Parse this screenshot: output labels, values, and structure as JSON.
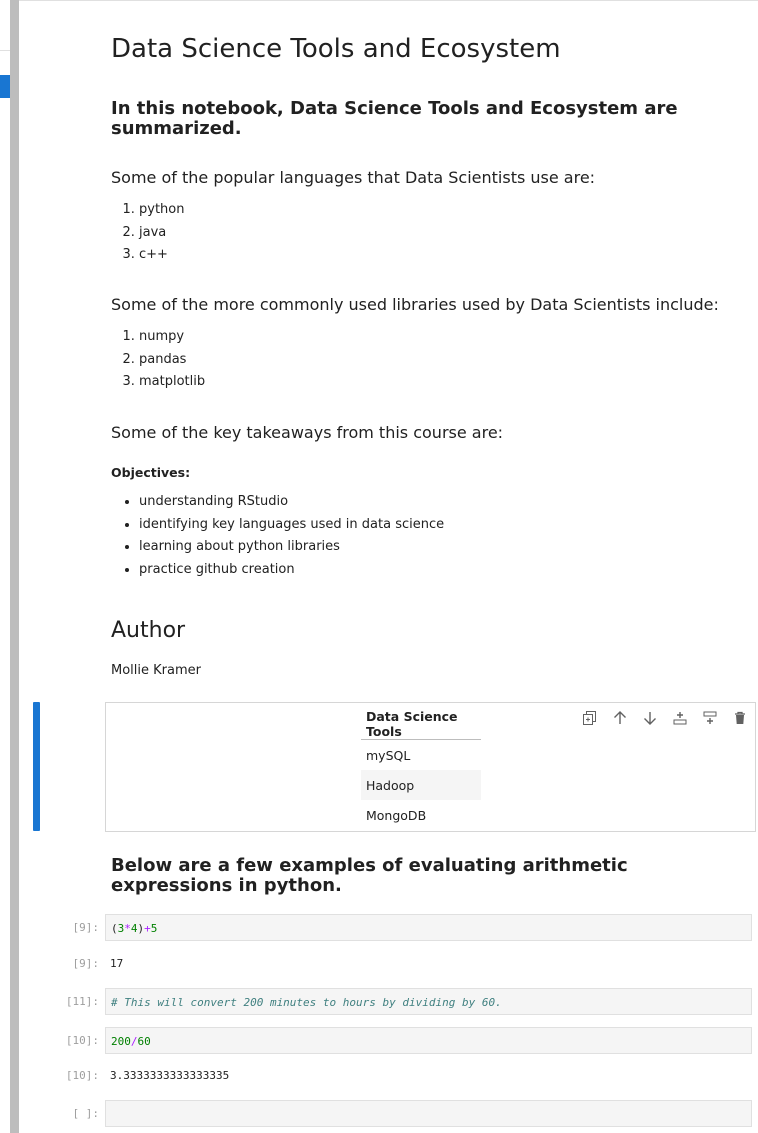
{
  "title": "Data Science Tools and Ecosystem",
  "intro_heading": "In this notebook, Data Science Tools and Ecosystem are summarized.",
  "languages": {
    "heading": "Some of the popular languages that Data Scientists use are:",
    "items": [
      "python",
      "java",
      "c++"
    ]
  },
  "libraries": {
    "heading": "Some of the more commonly used libraries used by Data Scientists include:",
    "items": [
      "numpy",
      "pandas",
      "matplotlib"
    ]
  },
  "takeaways": {
    "heading": "Some of the key takeaways from this course are:",
    "objectives_label": "Objectives:",
    "items": [
      "understanding RStudio",
      "identifying key languages used in data science",
      "learning about python libraries",
      "practice github creation"
    ]
  },
  "author": {
    "heading": "Author",
    "name": "Mollie Kramer"
  },
  "tools_table": {
    "header": "Data Science Tools",
    "rows": [
      "mySQL",
      "Hadoop",
      "MongoDB"
    ]
  },
  "toolbar": [
    "duplicate-icon",
    "move-up-icon",
    "move-down-icon",
    "insert-above-icon",
    "insert-below-icon",
    "delete-icon"
  ],
  "arith_heading": "Below are a few examples of evaluating arithmetic expressions in python.",
  "cells": {
    "c1": {
      "in_prompt": "[9]:",
      "out_prompt": "[9]:",
      "output": "17"
    },
    "c2": {
      "in_prompt": "[11]:",
      "code": "# This will convert 200 minutes to hours by dividing by 60."
    },
    "c3": {
      "in_prompt": "[10]:",
      "out_prompt": "[10]:",
      "output": "3.3333333333333335"
    },
    "c4": {
      "in_prompt": "[ ]:"
    }
  },
  "colors": {
    "accent": "#1976d2",
    "code_bg": "#f5f5f5",
    "number": "#008000",
    "comment": "#408080"
  }
}
